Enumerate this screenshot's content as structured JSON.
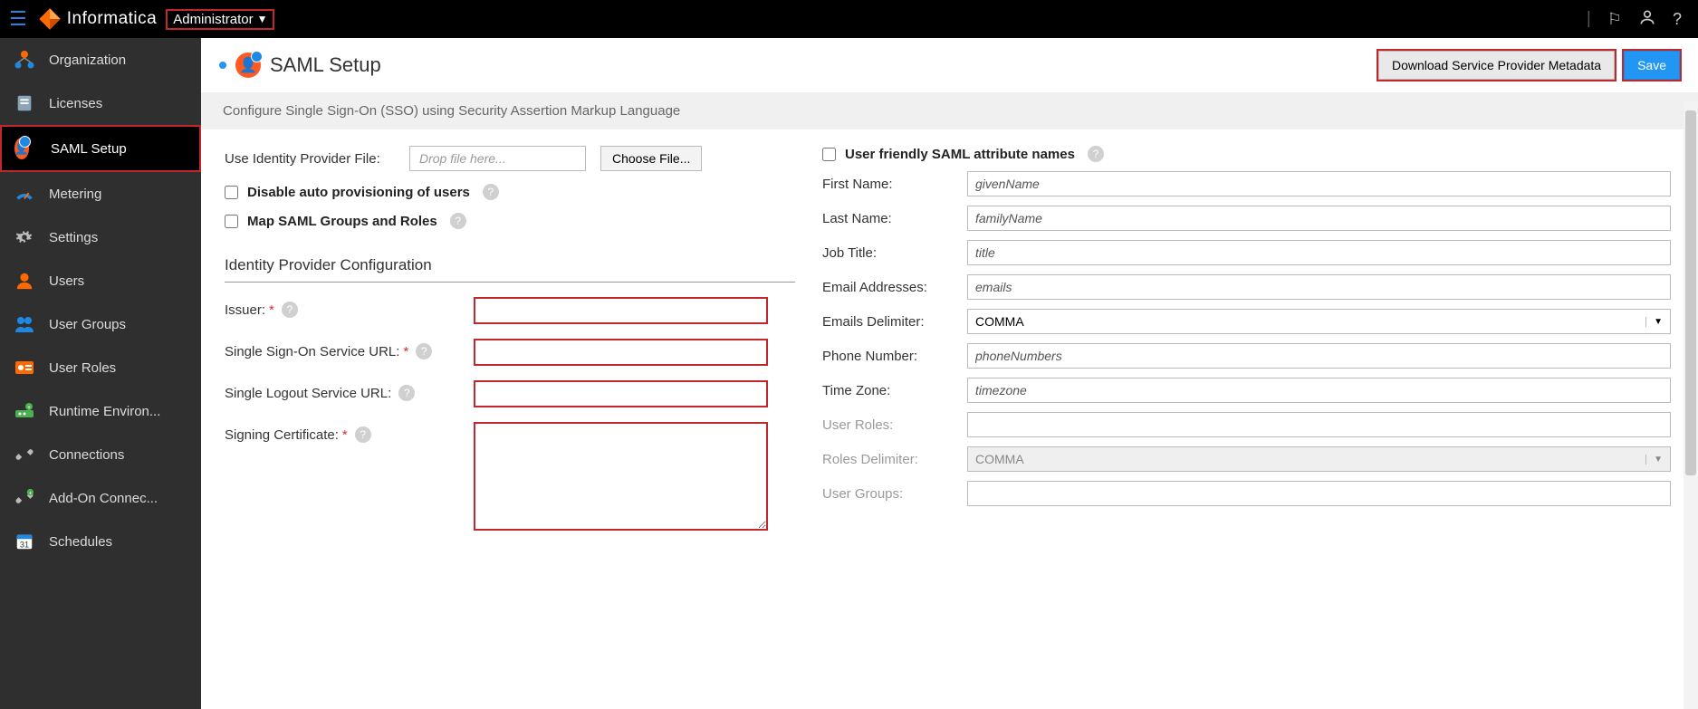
{
  "brand": "Informatica",
  "app_switcher": "Administrator",
  "page": {
    "title": "SAML Setup",
    "subtitle": "Configure Single Sign-On (SSO) using Security Assertion Markup Language"
  },
  "actions": {
    "download": "Download Service Provider Metadata",
    "save": "Save"
  },
  "sidebar": [
    {
      "label": "Organization",
      "icon": "org"
    },
    {
      "label": "Licenses",
      "icon": "license"
    },
    {
      "label": "SAML Setup",
      "icon": "saml",
      "active": true
    },
    {
      "label": "Metering",
      "icon": "meter"
    },
    {
      "label": "Settings",
      "icon": "settings"
    },
    {
      "label": "Users",
      "icon": "users"
    },
    {
      "label": "User Groups",
      "icon": "groups"
    },
    {
      "label": "User Roles",
      "icon": "roles"
    },
    {
      "label": "Runtime Environ...",
      "icon": "runtime"
    },
    {
      "label": "Connections",
      "icon": "conn"
    },
    {
      "label": "Add-On Connec...",
      "icon": "addon"
    },
    {
      "label": "Schedules",
      "icon": "sched"
    }
  ],
  "left_form": {
    "use_idp_file_label": "Use Identity Provider File:",
    "drop_placeholder": "Drop file here...",
    "choose_file": "Choose File...",
    "disable_auto_label": "Disable auto provisioning of users",
    "map_groups_label": "Map SAML Groups and Roles",
    "idp_section": "Identity Provider Configuration",
    "issuer_label": "Issuer:",
    "sso_url_label": "Single Sign-On Service URL:",
    "slo_url_label": "Single Logout Service URL:",
    "cert_label": "Signing Certificate:",
    "issuer_value": "",
    "sso_url_value": "",
    "slo_url_value": "",
    "cert_value": ""
  },
  "right_form": {
    "friendly_label": "User friendly SAML attribute names",
    "fields": {
      "first_name": {
        "label": "First Name:",
        "value": "givenName"
      },
      "last_name": {
        "label": "Last Name:",
        "value": "familyName"
      },
      "job_title": {
        "label": "Job Title:",
        "value": "title"
      },
      "emails": {
        "label": "Email Addresses:",
        "value": "emails"
      },
      "emails_delim": {
        "label": "Emails Delimiter:",
        "value": "COMMA"
      },
      "phone": {
        "label": "Phone Number:",
        "value": "phoneNumbers"
      },
      "timezone": {
        "label": "Time Zone:",
        "value": "timezone"
      },
      "user_roles": {
        "label": "User Roles:",
        "value": ""
      },
      "roles_delim": {
        "label": "Roles Delimiter:",
        "value": "COMMA"
      },
      "user_groups": {
        "label": "User Groups:",
        "value": ""
      }
    }
  }
}
